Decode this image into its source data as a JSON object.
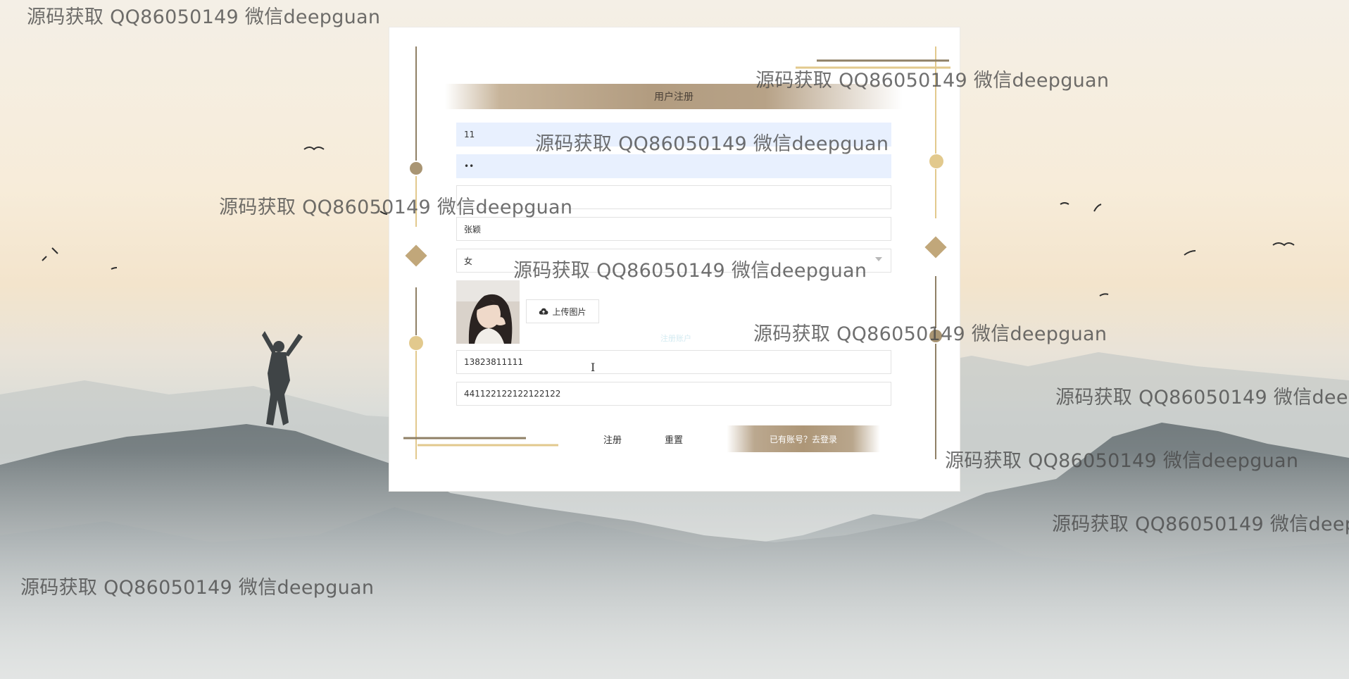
{
  "form": {
    "title": "用户注册",
    "fields": {
      "username": "11",
      "password": "••",
      "confirm_password": "",
      "name": "张颖",
      "gender": "女",
      "phone": "13823811111",
      "id_card": "441122122122122122"
    },
    "upload_label": "上传图片",
    "ghost_label": "注册账户",
    "register_label": "注册",
    "reset_label": "重置",
    "login_link": "已有账号？去登录"
  },
  "watermark_text": "源码获取 QQ86050149 微信deepguan",
  "colors": {
    "accent_gold": "#b29c80",
    "deco_gold": "#e2c98d",
    "deco_dark": "#8f8066",
    "field_autofill": "#e8f0fe"
  },
  "icons": {
    "upload": "cloud-upload-icon",
    "select": "chevron-down-icon"
  }
}
